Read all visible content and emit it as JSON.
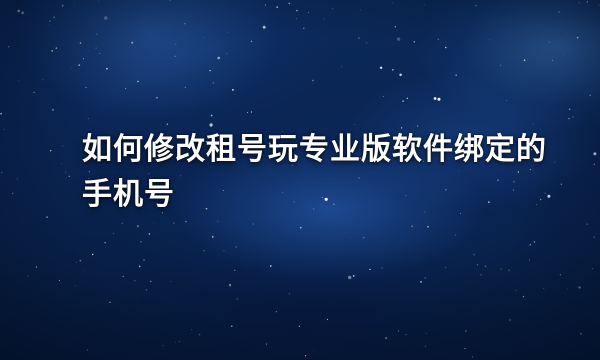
{
  "title": "如何修改租号玩专业版软件绑定的手机号",
  "background": {
    "description_colors": {
      "sky_top": "#0b2a5a",
      "sky_bottom": "#061a3a",
      "nebula_glow": "#4c8ee0",
      "star": "#ffffff"
    }
  }
}
